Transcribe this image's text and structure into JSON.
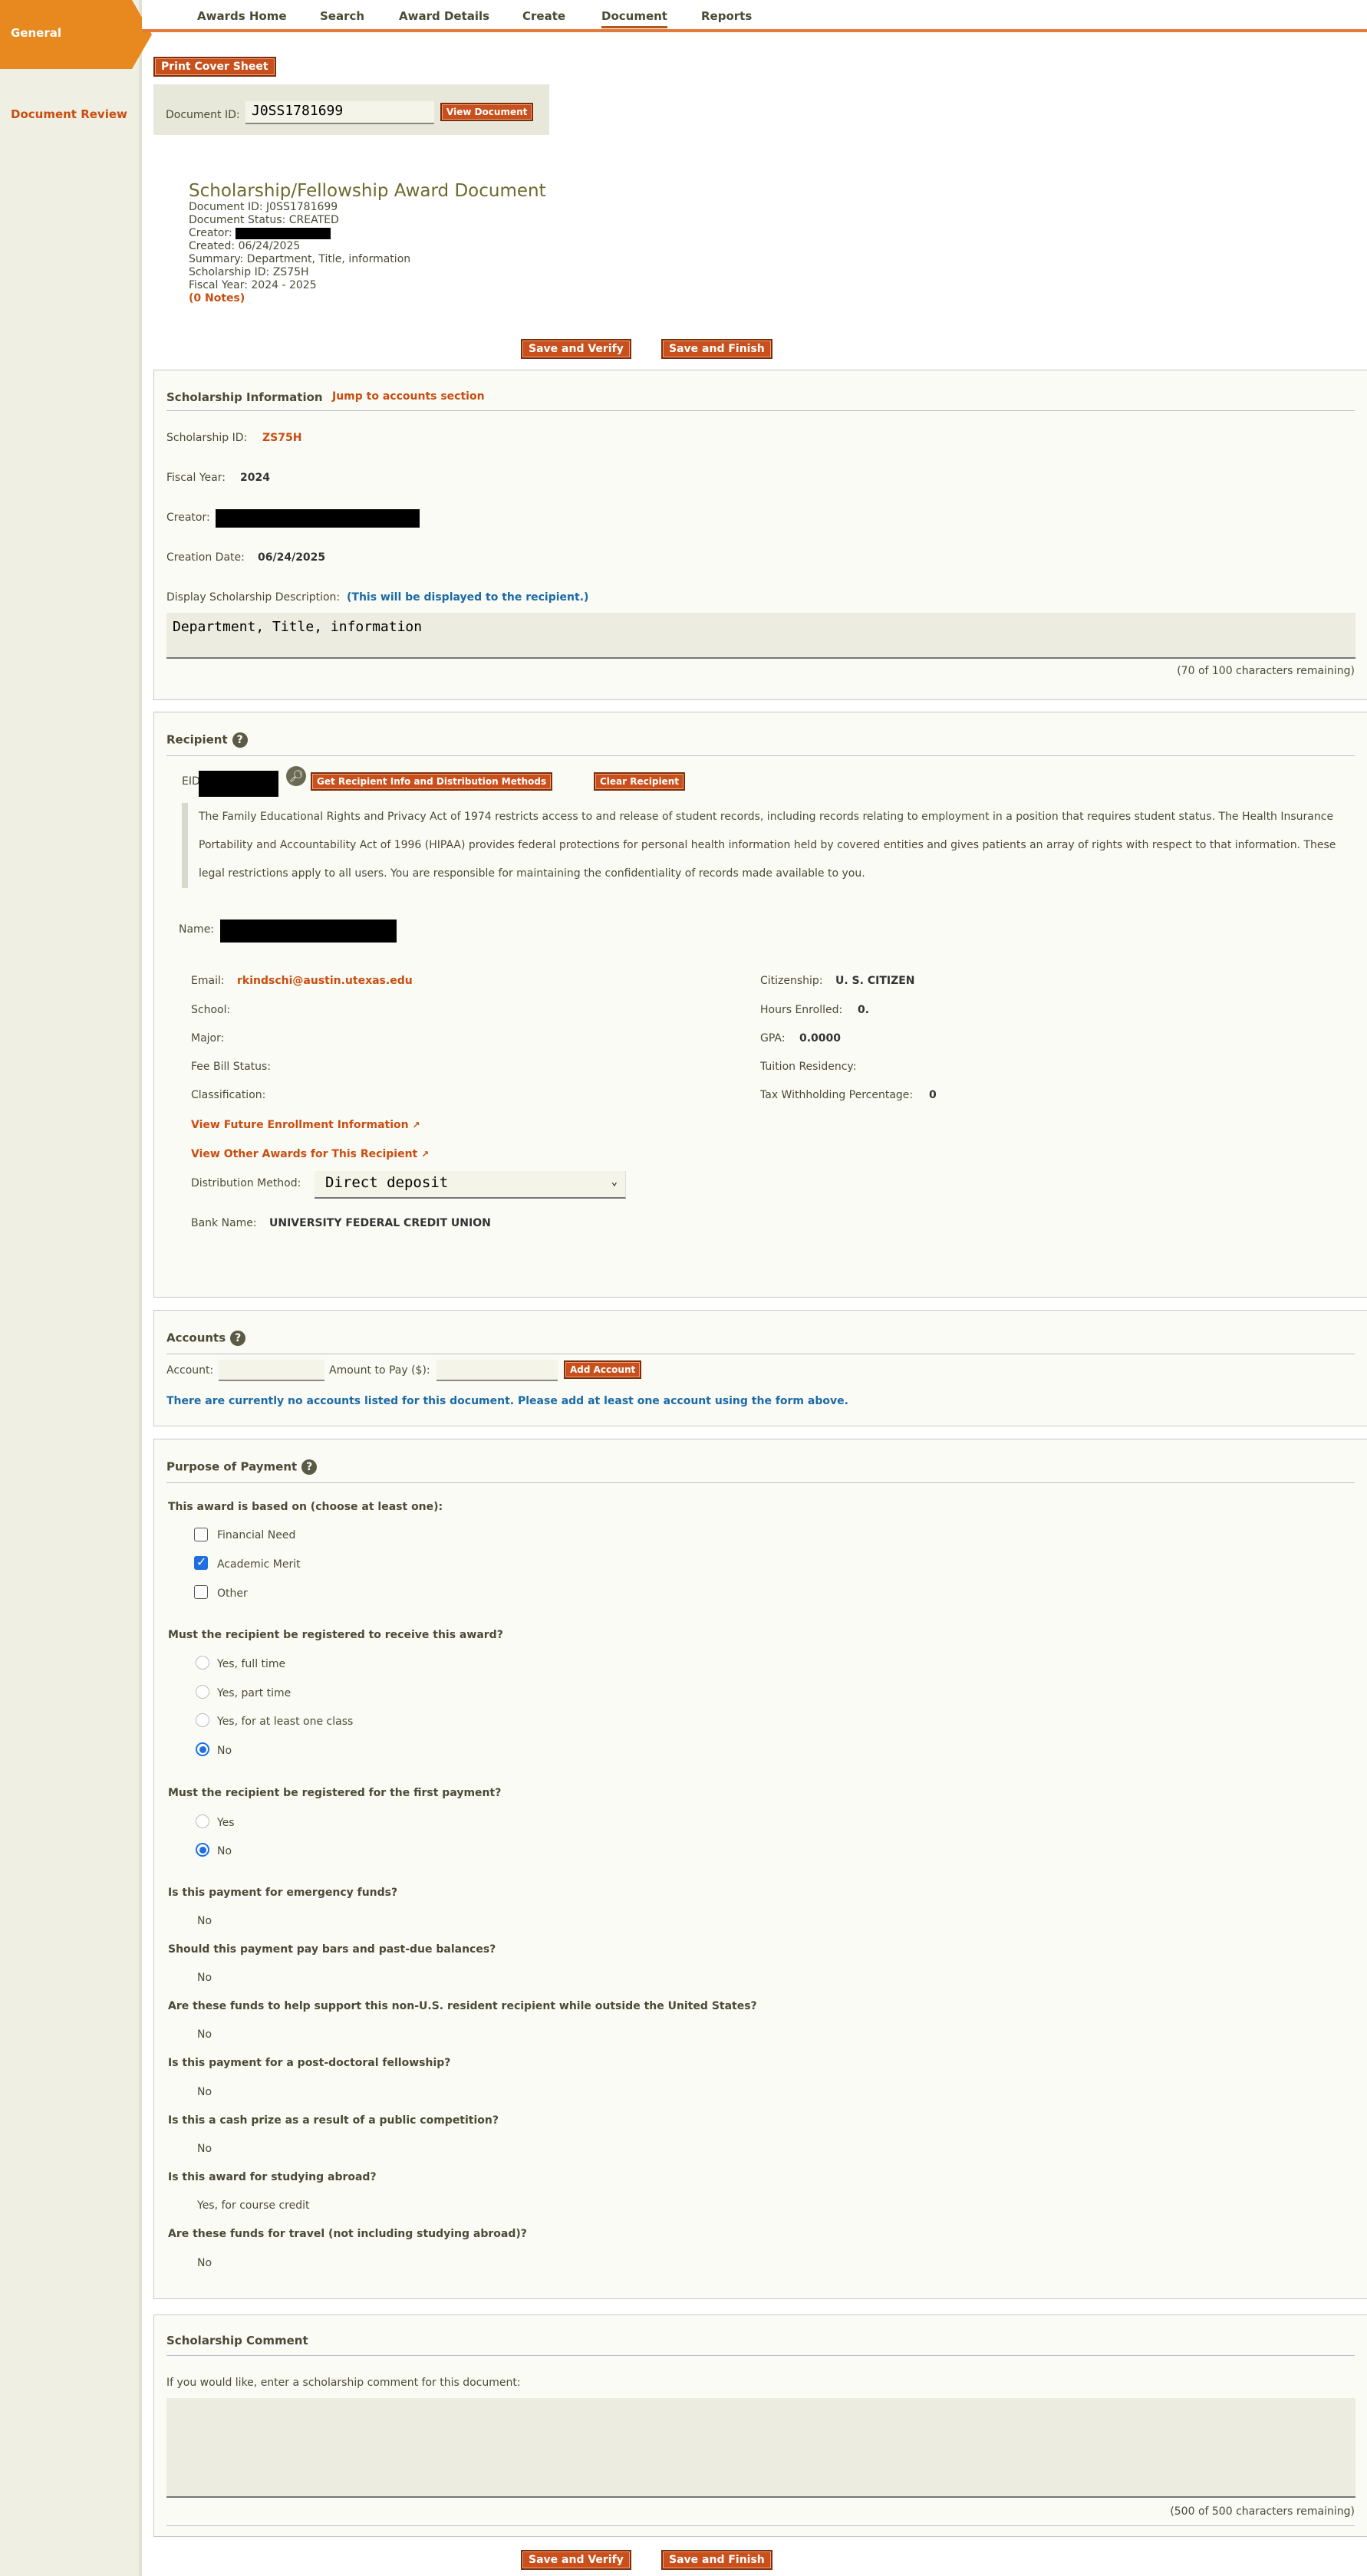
{
  "sidebar": {
    "general_label": "General",
    "review_label": "Document Review"
  },
  "nav": {
    "items": [
      "Awards Home",
      "Search",
      "Award Details",
      "Create",
      "Document",
      "Reports"
    ]
  },
  "toolbar": {
    "print_cover": "Print Cover Sheet",
    "doc_id_label": "Document ID:",
    "doc_id_value": "J0SS1781699",
    "view_document": "View Document"
  },
  "summary": {
    "title": "Scholarship/Fellowship Award Document",
    "doc_id": "Document ID: J0SS1781699",
    "status": "Document Status: CREATED",
    "creator_label": "Creator:",
    "created": "Created: 06/24/2025",
    "summary": "Summary: Department, Title, information",
    "scholarship_id": "Scholarship ID: ZS75H",
    "fiscal_year": "Fiscal Year: 2024 - 2025",
    "notes": "(0 Notes)"
  },
  "actions": {
    "save_verify": "Save and Verify",
    "save_finish": "Save and Finish"
  },
  "scholarship": {
    "heading": "Scholarship Information",
    "jump_link": "Jump to accounts section",
    "id_label": "Scholarship ID:",
    "id_value": "ZS75H",
    "fy_label": "Fiscal Year:",
    "fy_value": "2024",
    "creator_label": "Creator:",
    "creation_label": "Creation Date:",
    "creation_value": "06/24/2025",
    "desc_label": "Display Scholarship Description:",
    "desc_note": "(This will be displayed to the recipient.)",
    "desc_value": "Department, Title, information",
    "desc_remaining": "(70 of 100 characters remaining)"
  },
  "recipient": {
    "heading": "Recipient",
    "eid_label": "EID:",
    "get_info": "Get Recipient Info and Distribution Methods",
    "clear": "Clear Recipient",
    "ferpa": "The Family Educational Rights and Privacy Act of 1974 restricts access to and release of student records, including records relating to employment in a position that requires student status. The Health Insurance Portability and Accountability Act of 1996 (HIPAA) provides federal protections for personal health information held by covered entities and gives patients an array of rights with respect to that information. These legal restrictions apply to all users. You are responsible for maintaining the confidentiality of records made available to you.",
    "name_label": "Name:",
    "email_label": "Email:",
    "email_value": "rkindschi@austin.utexas.edu",
    "school_label": "School:",
    "major_label": "Major:",
    "fee_label": "Fee Bill Status:",
    "class_label": "Classification:",
    "citizenship_label": "Citizenship:",
    "citizenship_value": "U. S. CITIZEN",
    "hours_label": "Hours Enrolled:",
    "hours_value": "0.",
    "gpa_label": "GPA:",
    "gpa_value": "0.0000",
    "residency_label": "Tuition Residency:",
    "tax_label": "Tax Withholding Percentage:",
    "tax_value": "0",
    "future_link": "View Future Enrollment Information",
    "other_link": "View Other Awards for This Recipient",
    "dist_label": "Distribution Method:",
    "dist_value": "Direct deposit",
    "bank_label": "Bank Name:",
    "bank_value": "UNIVERSITY FEDERAL CREDIT UNION"
  },
  "accounts": {
    "heading": "Accounts",
    "account_label": "Account:",
    "amount_label": "Amount to Pay ($):",
    "add": "Add Account",
    "empty": "There are currently no accounts listed for this document. Please add at least one account using the form above."
  },
  "purpose": {
    "heading": "Purpose of Payment",
    "based_q": "This award is based on (choose at least one):",
    "based_opts": [
      "Financial Need",
      "Academic Merit",
      "Other"
    ],
    "reg_q": "Must the recipient be registered to receive this award?",
    "reg_opts": [
      "Yes, full time",
      "Yes, part time",
      "Yes, for at least one class",
      "No"
    ],
    "first_q": "Must the recipient be registered for the first payment?",
    "first_opts": [
      "Yes",
      "No"
    ],
    "emergency_q": "Is this payment for emergency funds?",
    "emergency_a": "No",
    "bars_q": "Should this payment pay bars and past-due balances?",
    "bars_a": "No",
    "nonus_q": "Are these funds to help support this non-U.S. resident recipient while outside the United States?",
    "nonus_a": "No",
    "postdoc_q": "Is this payment for a post-doctoral fellowship?",
    "postdoc_a": "No",
    "prize_q": "Is this a cash prize as a result of a public competition?",
    "prize_a": "No",
    "abroad_q": "Is this award for studying abroad?",
    "abroad_a": "Yes, for course credit",
    "travel_q": "Are these funds for travel (not including studying abroad)?",
    "travel_a": "No"
  },
  "comment": {
    "heading": "Scholarship Comment",
    "prompt": "If you would like, enter a scholarship comment for this document:",
    "remaining": "(500 of 500 characters remaining)"
  }
}
